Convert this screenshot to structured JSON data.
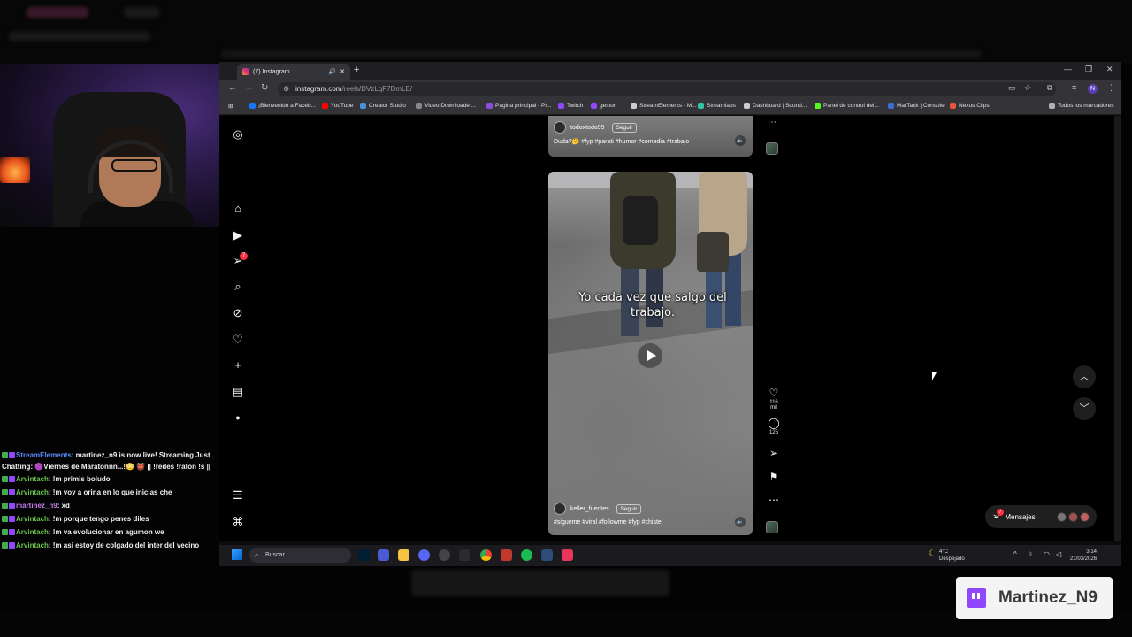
{
  "colors": {
    "accent": "#9146ff",
    "instagram_red": "#ff3040",
    "chat_green": "#6ac44a",
    "stream_elements_blue": "#5b8cff"
  },
  "chat": {
    "messages": [
      {
        "user": "StreamElements",
        "color": "#5b8cff",
        "text": ": martinez_n9 is now live! Streaming Just Chatting: 🟣Viernes de Maratonnn...!😳 👹 || !redes !raton !s ||"
      },
      {
        "user": "Arvintach",
        "color": "#6ac44a",
        "text": ": !m primis boludo"
      },
      {
        "user": "Arvintach",
        "color": "#6ac44a",
        "text": ": !m voy a orina en lo que inicias che"
      },
      {
        "user": "martinez_n9",
        "color": "#c87ef0",
        "text": ": xd"
      },
      {
        "user": "Arvintach",
        "color": "#6ac44a",
        "text": ": !m porque tengo penes diles"
      },
      {
        "user": "Arvintach",
        "color": "#6ac44a",
        "text": ": !m va evolucionar en agumon we"
      },
      {
        "user": "Arvintach",
        "color": "#6ac44a",
        "text": ": !m asi estoy de colgado del inter del vecino"
      }
    ]
  },
  "browser": {
    "tab_title": "(7) Instagram",
    "new_tab": "+",
    "url_host": "instagram.com",
    "url_path": "/reels/DVzLqF7DmLE/",
    "bookmarks": [
      {
        "label": "¡Bienvenido a Faceb...",
        "color": "#1877f2"
      },
      {
        "label": "YouTube",
        "color": "#ff0000"
      },
      {
        "label": "Creator Studio",
        "color": "#4a90d9"
      },
      {
        "label": "Video Downloader...",
        "color": "#888888"
      },
      {
        "label": "Página principal - Pr...",
        "color": "#8a4fd6"
      },
      {
        "label": "Twitch",
        "color": "#9146ff"
      },
      {
        "label": "gestor",
        "color": "#9146ff"
      },
      {
        "label": "StreamElements - M...",
        "color": "#cccccc"
      },
      {
        "label": "Streamlabs",
        "color": "#31c3a2"
      },
      {
        "label": "Dashboard | Sound...",
        "color": "#cccccc"
      },
      {
        "label": "Panel de control del...",
        "color": "#53fc18"
      },
      {
        "label": "MarTack | Console",
        "color": "#3b6fd8"
      },
      {
        "label": "Nexus Clips",
        "color": "#e8553a"
      }
    ],
    "all_bookmarks": "Todos los marcadores",
    "profile_initial": "N"
  },
  "instagram": {
    "notifications_count": "7",
    "top_reel": {
      "username": "todoxtodo99",
      "follow": "Seguir",
      "caption": "Duda?🤔 #fyp #parati #humor #comedia #trabajo"
    },
    "main_reel": {
      "overlay_text": "Yo cada vez que salgo del trabajo.",
      "username": "keller_fuentes",
      "follow": "Seguir",
      "tags": "#sigueme #viral #followme #fyp #chiste"
    },
    "actions": {
      "likes": "116 mil",
      "comments": "125"
    },
    "messages_label": "Mensajes",
    "messages_badge": "7"
  },
  "taskbar": {
    "search_placeholder": "Buscar",
    "weather_temp": "4°C",
    "weather_desc": "Despejado",
    "time": "3:14",
    "date": "21/03/2026"
  },
  "overlay": {
    "twitch_name": "Martinez_N9"
  }
}
